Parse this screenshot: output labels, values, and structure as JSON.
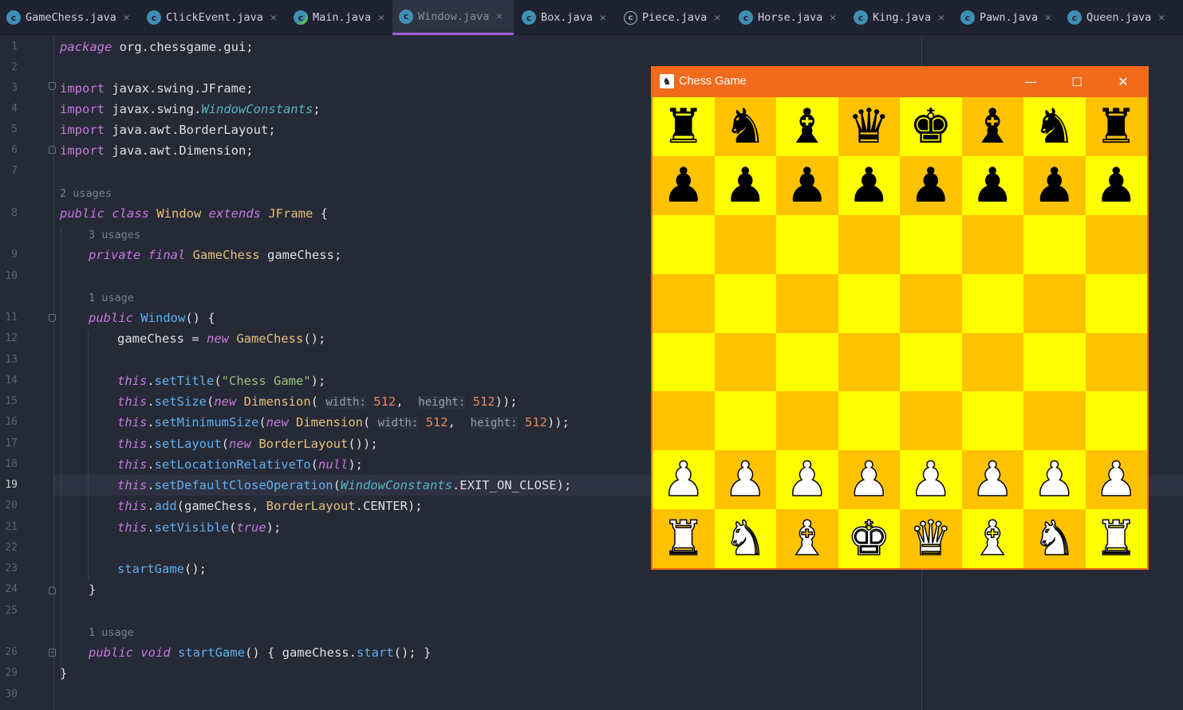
{
  "tabs": [
    {
      "label": "GameChess.java",
      "icon": "java-class-icon"
    },
    {
      "label": "ClickEvent.java",
      "icon": "java-class-icon"
    },
    {
      "label": "Main.java",
      "icon": "java-runnable-class-icon"
    },
    {
      "label": "Window.java",
      "icon": "java-class-icon",
      "active": true
    },
    {
      "label": "Box.java",
      "icon": "java-class-icon"
    },
    {
      "label": "Piece.java",
      "icon": "java-abstract-class-icon"
    },
    {
      "label": "Horse.java",
      "icon": "java-class-icon"
    },
    {
      "label": "King.java",
      "icon": "java-class-icon"
    },
    {
      "label": "Pawn.java",
      "icon": "java-class-icon"
    },
    {
      "label": "Queen.java",
      "icon": "java-class-icon"
    }
  ],
  "editor": {
    "current_line": "19",
    "line_numbers": [
      "1",
      "2",
      "3",
      "4",
      "5",
      "6",
      "7",
      "8",
      "9",
      "10",
      "11",
      "12",
      "13",
      "14",
      "15",
      "16",
      "17",
      "18",
      "19",
      "20",
      "21",
      "22",
      "23",
      "24",
      "25",
      "26",
      "29",
      "30"
    ],
    "usage_hints": [
      "2 usages",
      "3 usages",
      "1 usage",
      "1 usage"
    ],
    "code": {
      "l1": [
        "package",
        " org.chessgame.gui;"
      ],
      "l3": [
        "import",
        " javax.swing.JFrame;"
      ],
      "l4": [
        "import",
        " javax.swing.",
        "WindowConstants",
        ";"
      ],
      "l5": [
        "import",
        " java.awt.BorderLayout;"
      ],
      "l6": [
        "import",
        " java.awt.Dimension;"
      ],
      "l8": [
        "public class ",
        "Window",
        " extends ",
        "JFrame",
        " {"
      ],
      "l9": [
        "private final ",
        "GameChess",
        " gameChess;"
      ],
      "l11": [
        "public ",
        "Window",
        "() {"
      ],
      "l12": [
        "gameChess = ",
        "new ",
        "GameChess",
        "();"
      ],
      "l14": [
        "this",
        ".",
        "setTitle",
        "(",
        "\"Chess Game\"",
        ");"
      ],
      "l15": [
        "this",
        ".",
        "setSize",
        "(",
        "new ",
        "Dimension",
        "( ",
        "width:",
        " ",
        "512",
        ",  ",
        "height:",
        " ",
        "512",
        "));"
      ],
      "l16": [
        "this",
        ".",
        "setMinimumSize",
        "(",
        "new ",
        "Dimension",
        "( ",
        "width:",
        " ",
        "512",
        ",  ",
        "height:",
        " ",
        "512",
        "));"
      ],
      "l17": [
        "this",
        ".",
        "setLayout",
        "(",
        "new ",
        "BorderLayout",
        "());"
      ],
      "l18": [
        "this",
        ".",
        "setLocationRelativeTo",
        "(",
        "null",
        ");"
      ],
      "l19": [
        "this",
        ".",
        "setDefaultCloseOperation",
        "(",
        "WindowConstants",
        ".EXIT_ON_CLOSE);"
      ],
      "l20": [
        "this",
        ".",
        "add",
        "(gameChess, ",
        "BorderLayout",
        ".CENTER);"
      ],
      "l21": [
        "this",
        ".",
        "setVisible",
        "(",
        "true",
        ");"
      ],
      "l23": [
        "startGame",
        "();"
      ],
      "l24": [
        "}"
      ],
      "l26": [
        "public void ",
        "startGame",
        "() { gameChess.",
        "start",
        "(); }"
      ],
      "l29": [
        "}"
      ]
    }
  },
  "chess_window": {
    "title": "Chess Game",
    "minimize_glyph": "—",
    "maximize_glyph": "☐",
    "close_glyph": "✕",
    "board_colors": {
      "light": "#ffff00",
      "dark": "#ffc200"
    },
    "rows": [
      [
        "♜",
        "♞",
        "♝",
        "♛",
        "♚",
        "♝",
        "♞",
        "♜"
      ],
      [
        "♟",
        "♟",
        "♟",
        "♟",
        "♟",
        "♟",
        "♟",
        "♟"
      ],
      [
        "",
        "",
        "",
        "",
        "",
        "",
        "",
        ""
      ],
      [
        "",
        "",
        "",
        "",
        "",
        "",
        "",
        ""
      ],
      [
        "",
        "",
        "",
        "",
        "",
        "",
        "",
        ""
      ],
      [
        "",
        "",
        "",
        "",
        "",
        "",
        "",
        ""
      ],
      [
        "♟",
        "♟",
        "♟",
        "♟",
        "♟",
        "♟",
        "♟",
        "♟"
      ],
      [
        "♜",
        "♞",
        "♝",
        "♚",
        "♛",
        "♝",
        "♞",
        "♜"
      ]
    ],
    "piece_colors": [
      "black",
      "black",
      "",
      "",
      "",
      "",
      "white",
      "white"
    ]
  }
}
